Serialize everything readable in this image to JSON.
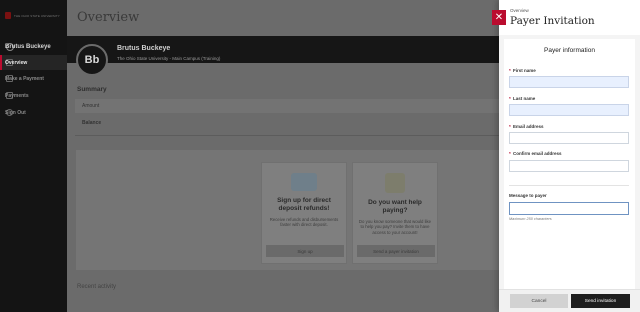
{
  "sidebar": {
    "logo_text": "THE OHIO STATE UNIVERSITY",
    "user_name": "Brutus Buckeye",
    "items": [
      {
        "label": "Overview",
        "icon": "home-icon"
      },
      {
        "label": "Make a Payment",
        "icon": "card-icon"
      },
      {
        "label": "Payments",
        "icon": "list-icon"
      },
      {
        "label": "Sign Out",
        "icon": "sign-out-icon"
      }
    ]
  },
  "main": {
    "title": "Overview",
    "profile": {
      "initials": "Bb",
      "name": "Brutus Buckeye",
      "subtitle": "The Ohio State University - Main Campus (Training)"
    },
    "summary": {
      "heading": "Summary",
      "row1": "Amount",
      "row2": "Balance"
    },
    "cards": [
      {
        "title": "Sign up for direct deposit refunds!",
        "body": "Receive refunds and disbursements faster with direct deposit.",
        "button": "Sign up"
      },
      {
        "title": "Do you want help paying?",
        "body": "Do you know someone that would like to help you pay? Invite them to have access to your account!",
        "button": "Send a payer invitation"
      }
    ],
    "bottom_heading": "Recent activity"
  },
  "panel": {
    "eyebrow": "Overview",
    "title": "Payer Invitation",
    "close_icon": "close-icon",
    "form_heading": "Payer information",
    "required_mark": "*",
    "fields": {
      "first_name_label": "First name",
      "last_name_label": "Last name",
      "email_label": "Email address",
      "confirm_email_label": "Confirm email address",
      "message_label": "Message to payer",
      "message_hint": "Maximum 250 characters"
    },
    "cancel_label": "Cancel",
    "send_label": "Send invitation"
  },
  "colors": {
    "accent": "#ba0c2f",
    "overlay": "#6b6b6b",
    "send_button": "#1e1e1e",
    "autofill": "#e8f0fe"
  }
}
